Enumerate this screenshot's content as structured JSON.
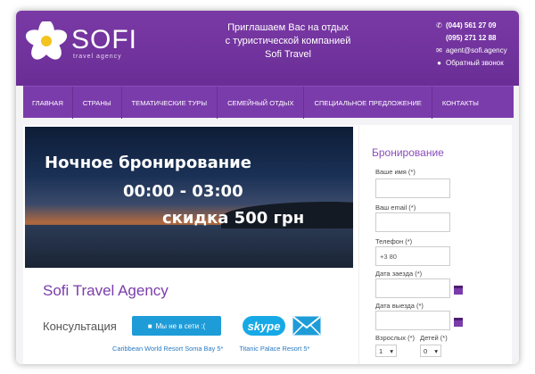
{
  "header": {
    "logo_text": "SOFI",
    "logo_subtitle": "travel agency",
    "tagline": [
      "Приглашаем Вас на отдых",
      "с туристической компанией",
      "Sofi Travel"
    ],
    "phone1": "(044) 561 27 09",
    "phone2": "(095) 271 12 88",
    "email": "agent@sofi.agency",
    "callback": "Обратный звонок"
  },
  "nav": {
    "items": [
      "ГЛАВНАЯ",
      "СТРАНЫ",
      "ТЕМАТИЧЕСКИЕ ТУРЫ",
      "СЕМЕЙНЫЙ ОТДЫХ",
      "СПЕЦИАЛЬНОЕ ПРЕДЛОЖЕНИЕ",
      "КОНТАКТЫ"
    ]
  },
  "banner": {
    "line1": "Ночное бронирование",
    "line2": "00:00 - 03:00",
    "line3": "скидка 500 грн"
  },
  "main": {
    "agency_title": "Sofi Travel Agency",
    "consult_label": "Консультация",
    "chat_button": "Мы не в сети :(",
    "skype_label": "skype",
    "links": [
      "Caribbean World Resort Soma Bay 5*",
      "Titanic Palace Resort 5*"
    ]
  },
  "booking": {
    "title": "Бронирование",
    "name_label": "Ваше имя (*)",
    "name_value": "",
    "email_label": "Ваш email (*)",
    "email_value": "",
    "phone_label": "Телефон (*)",
    "phone_value": "+3 80",
    "arrival_label": "Дата заезда (*)",
    "arrival_value": "",
    "departure_label": "Дата выезда (*)",
    "departure_value": "",
    "adults_label": "Взрослых (*)",
    "adults_value": "1",
    "children_label": "Детей (*)",
    "children_value": "0"
  },
  "colors": {
    "brand_purple": "#7b3cab",
    "chat_blue": "#1e9cd8",
    "link_blue": "#2a7ac0"
  },
  "icons": [
    "flower-logo-icon",
    "phone-icon",
    "mail-icon",
    "chat-bubble-icon",
    "calendar-icon",
    "envelope-icon",
    "chevron-down-icon"
  ]
}
